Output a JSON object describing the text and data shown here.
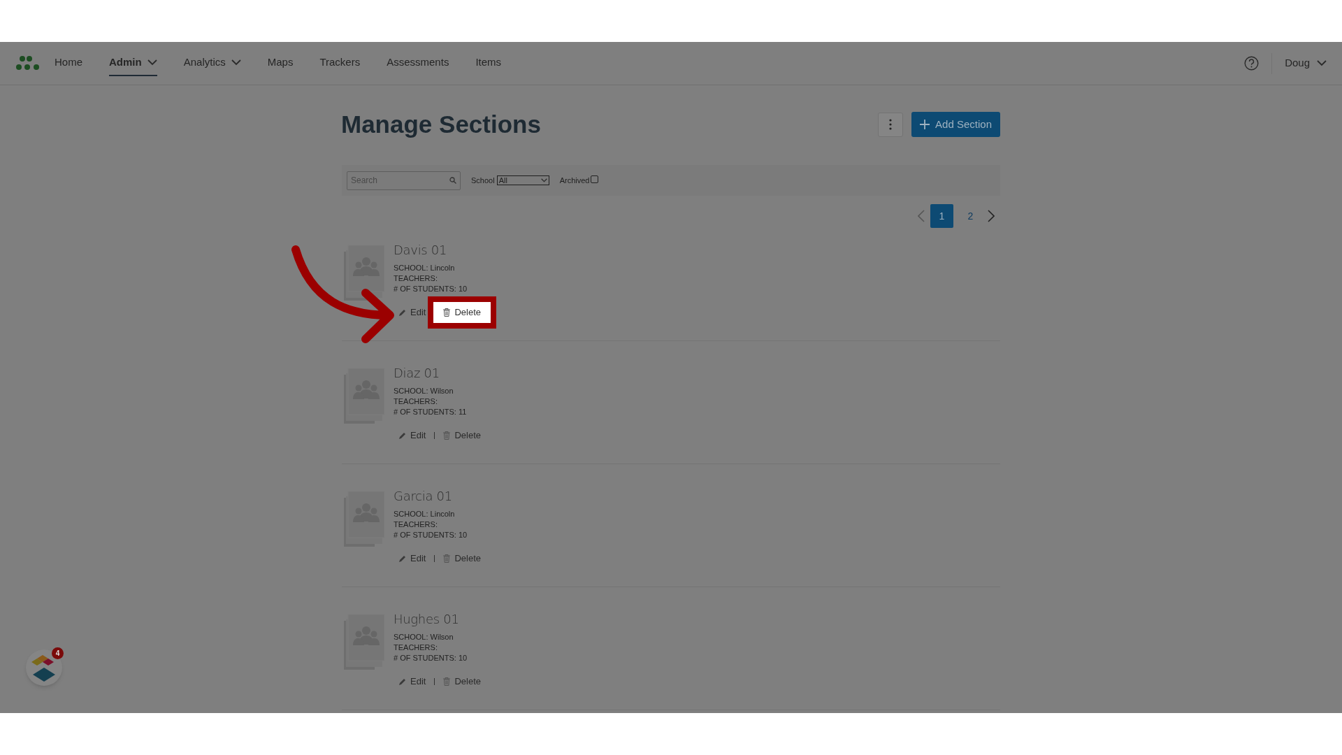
{
  "nav": {
    "items": [
      {
        "label": "Home",
        "selected": false,
        "dropdown": false
      },
      {
        "label": "Admin",
        "selected": true,
        "dropdown": true
      },
      {
        "label": "Analytics",
        "selected": false,
        "dropdown": true
      },
      {
        "label": "Maps",
        "selected": false,
        "dropdown": false
      },
      {
        "label": "Trackers",
        "selected": false,
        "dropdown": false
      },
      {
        "label": "Assessments",
        "selected": false,
        "dropdown": false
      },
      {
        "label": "Items",
        "selected": false,
        "dropdown": false
      }
    ]
  },
  "user": {
    "name": "Doug"
  },
  "page": {
    "title": "Manage Sections",
    "add_button": "Add Section"
  },
  "filters": {
    "search": {
      "placeholder": "Search"
    },
    "school": {
      "label": "School",
      "value": "All"
    },
    "archived": {
      "label": "Archived",
      "checked": false
    }
  },
  "pagination": {
    "pages": [
      {
        "label": "1",
        "selected": true
      },
      {
        "label": "2",
        "selected": false
      }
    ]
  },
  "sections": [
    {
      "name": "Davis 01",
      "school": "SCHOOL: Lincoln",
      "teachers": "TEACHERS:",
      "students": "# OF STUDENTS: 10",
      "edit": "Edit",
      "delete": "Delete",
      "highlighted": true
    },
    {
      "name": "Diaz 01",
      "school": "SCHOOL: Wilson",
      "teachers": "TEACHERS:",
      "students": "# OF STUDENTS: 11",
      "edit": "Edit",
      "delete": "Delete",
      "highlighted": false
    },
    {
      "name": "Garcia 01",
      "school": "SCHOOL: Lincoln",
      "teachers": "TEACHERS:",
      "students": "# OF STUDENTS: 10",
      "edit": "Edit",
      "delete": "Delete",
      "highlighted": false
    },
    {
      "name": "Hughes 01",
      "school": "SCHOOL: Wilson",
      "teachers": "TEACHERS:",
      "students": "# OF STUDENTS: 10",
      "edit": "Edit",
      "delete": "Delete",
      "highlighted": false
    }
  ],
  "widget": {
    "badge": "4"
  }
}
